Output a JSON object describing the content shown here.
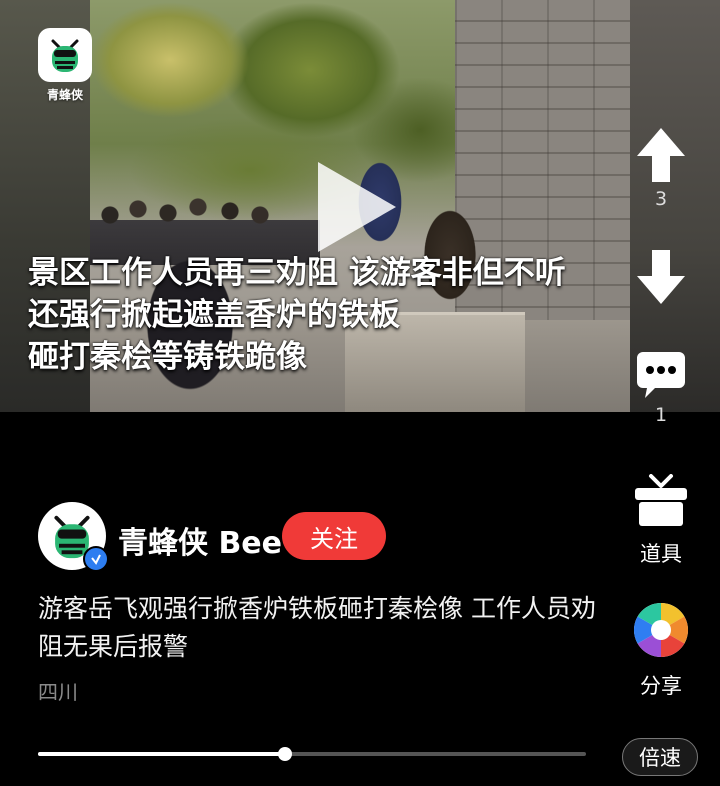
{
  "brand": {
    "logo_text": "青蜂侠"
  },
  "video": {
    "caption_lines": [
      "景区工作人员再三劝阻 该游客非但不听",
      "还强行掀起遮盖香炉的铁板",
      "砸打秦桧等铸铁跪像"
    ],
    "progress": 0.45
  },
  "rail": {
    "upvote": {
      "icon": "up-arrow-icon",
      "count": "3"
    },
    "downvote": {
      "icon": "down-arrow-icon"
    },
    "comments": {
      "icon": "comment-icon",
      "count": "1"
    },
    "props": {
      "icon": "gift-box-icon",
      "label": "道具"
    },
    "share": {
      "icon": "share-aperture-icon",
      "label": "分享"
    }
  },
  "author": {
    "name": "青蜂侠 Bee",
    "follow_label": "关注"
  },
  "post": {
    "description": "游客岳飞观强行掀香炉铁板砸打秦桧像 工作人员劝阻无果后报警",
    "location": "四川"
  },
  "player": {
    "speed_label": "倍速"
  },
  "colors": {
    "follow": "#f03a38",
    "verified": "#2d7df0",
    "logo_green": "#2bb673"
  }
}
